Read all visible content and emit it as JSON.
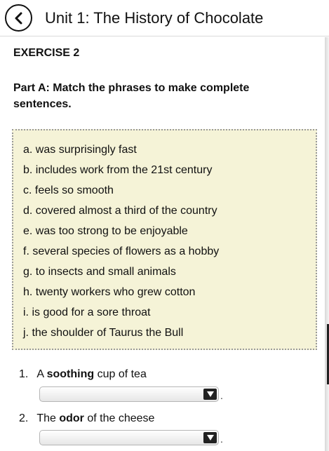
{
  "header": {
    "title": "Unit 1: The History of Chocolate",
    "back_icon": "chevron-left-icon"
  },
  "exercise": {
    "label": "EXERCISE 2",
    "instruction": "Part A: Match the phrases to make complete sentences."
  },
  "phrases": [
    "a. was surprisingly fast",
    "b. includes work from the 21st century",
    "c. feels so smooth",
    "d. covered almost a third of the country",
    "e. was too strong to be enjoyable",
    "f. several species of flowers as a hobby",
    "g. to insects and small animals",
    "h. twenty workers who grew cotton",
    "i. is good for a sore throat",
    "j. the shoulder of Taurus the Bull"
  ],
  "questions": [
    {
      "number": "1.",
      "before": "A ",
      "keyword": "soothing",
      "after": " cup of tea",
      "selected": "",
      "trailing": "."
    },
    {
      "number": "2.",
      "before": "The ",
      "keyword": "odor",
      "after": " of the cheese",
      "selected": "",
      "trailing": "."
    }
  ],
  "colors": {
    "phrase_box_bg": "#f5f3d7",
    "phrase_box_border": "#9a9a9a"
  }
}
